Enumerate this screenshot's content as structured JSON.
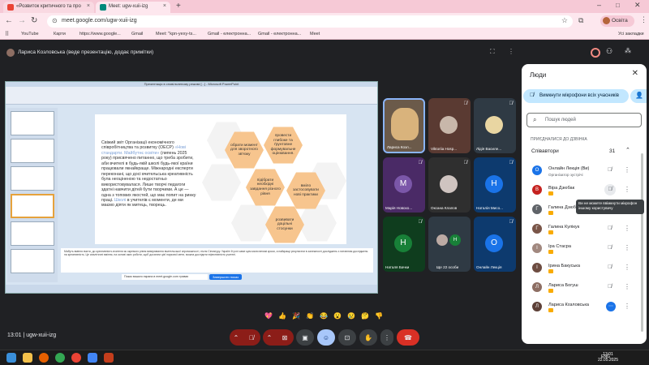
{
  "browser": {
    "tabs": [
      {
        "title": "«Розвиток критичного та про",
        "active": false
      },
      {
        "title": "Meet: ugw-xuii-izg",
        "active": true
      }
    ],
    "url": "meet.google.com/ugw-xuii-izg",
    "profile": "Освіта",
    "bookmarks": [
      "YouTube",
      "Карти",
      "https://www.google...",
      "Gmail",
      "Meet: \"kpn-yexy-ts...",
      "Gmail - електронна...",
      "Gmail - електронна...",
      "Meet"
    ],
    "all_bookmarks": "Усі закладки"
  },
  "meet": {
    "presenter_label": "Лариса Козловська (веде презентацію, додає примітки)",
    "slide": {
      "window_title": "Презентація в сповільненому режимі [...] - Microsoft PowerPoint",
      "text_before": "Свіжий звіт Організації економічного співробітництва та розвитку (ОЕСР) ",
      "text_link": "«Нові стандарти. Майбутнє освіти»",
      "text_mid": " (липень 2025 року) присвячено питанню, що треба зробити, аби вчителі в будь-якій школі будь-якої країни працювали якнайкраще. Міжнародні експерти переконані, що досі вчительська креативність була неоціненою та недостатньо використовувалася. Лише творчі педагоги здатні навчити дітей бути творчими. А це — одна з топових якостей, що має попит на ринку праці. ",
      "text_link2": "Школі",
      "text_after": " в учителів є моменти, де ми маємо діяти як митець, творець.",
      "hexagons": [
        "обрати момент для зворотного зв'язку",
        "провести глибоке та ґрунтовне формувальне оцінювання.",
        "підібрати необхідні завдання різного рівня",
        "вміло застосовувати нові практики",
        "розвивати доцільні стосунки"
      ],
      "notes": "Мабуть вміння вчити, до креативність вчителя як окремого рівня вимірювання вчительської спроможності, після Сінгапуру. Україні й учні саме цим мали великі кроки, а найкращі результати в залежності досліджень з питанням досліджень на креативність. Це аналітичні вміння, на основі яких робити, щоб досягати цієї наукової мети, можна дослідити ефективність учителі.",
      "stop_share": "Завершити показ",
      "share_notice": "Показ вашого екрана в meet.google.com триває"
    },
    "participants": [
      {
        "name": "Лариса Козл...",
        "initial": "",
        "color": "#6b5a4a",
        "muted": false
      },
      {
        "name": "Viktoriia Hosp...",
        "initial": "",
        "color": "#5a3a32",
        "muted": true
      },
      {
        "name": "Лідія Василе...",
        "initial": "",
        "color": "#2f3a44",
        "muted": true
      },
      {
        "name": "Марія Новохо...",
        "initial": "М",
        "color": "#7b57a9",
        "muted": true
      },
      {
        "name": "Оксана Клапов",
        "initial": "",
        "color": "#2f2f2f",
        "muted": true
      },
      {
        "name": "Наталія Мисо...",
        "initial": "Н",
        "color": "#1a73e8",
        "muted": true
      },
      {
        "name": "Наталя Бачки",
        "initial": "Н",
        "color": "#188038",
        "muted": true
      },
      {
        "name": "Ще 22 особи",
        "initial": "Н",
        "color": "#2f3a44",
        "muted": false
      },
      {
        "name": "Онлайн Лекція",
        "initial": "О",
        "color": "#1a73e8",
        "muted": true
      }
    ],
    "reactions": [
      "💖",
      "👍",
      "🎉",
      "👏",
      "😂",
      "😮",
      "😢",
      "🤔",
      "👎"
    ],
    "meeting_time": "13:01",
    "meeting_code": "ugw-xuii-izg",
    "controls": [
      "chevron-up",
      "mic-off",
      "chevron-up",
      "camera-off",
      "present",
      "emoji",
      "captions",
      "raise-hand",
      "more",
      "leave"
    ]
  },
  "people_panel": {
    "title": "Люди",
    "mute_all": "Вимкнути мікрофони всіх учасників",
    "search_placeholder": "Пошук людей",
    "joined_label": "ПРИЄДНАЛИСЯ ДО ДЗВІНКА",
    "contributors_label": "Співавтори",
    "contributors_count": "31",
    "people": [
      {
        "name": "Онлайн Лекція (Ви)",
        "subtitle": "Організатор зустрічі",
        "initial": "О",
        "color": "#1a73e8",
        "badge": false
      },
      {
        "name": "Віра Дзюбак",
        "subtitle": "",
        "initial": "В",
        "color": "#c5221f",
        "badge": true
      },
      {
        "name": "Галина Дзюба",
        "subtitle": "",
        "initial": "Г",
        "color": "#5f6368",
        "badge": true
      },
      {
        "name": "Галина Кулікук",
        "subtitle": "",
        "initial": "Г",
        "color": "#795548",
        "badge": true
      },
      {
        "name": "Іра Стасра",
        "subtitle": "",
        "initial": "І",
        "color": "#a1887f",
        "badge": true
      },
      {
        "name": "Ірина Бакуська",
        "subtitle": "",
        "initial": "І",
        "color": "#6d4c41",
        "badge": true
      },
      {
        "name": "Лариса Богуш",
        "subtitle": "",
        "initial": "Л",
        "color": "#8d6e63",
        "badge": true
      },
      {
        "name": "Лариса Козловська",
        "subtitle": "",
        "initial": "Л",
        "color": "#5d4037",
        "badge": true
      }
    ],
    "tooltip": "Ви не можете ввімкнути мікрофон іншому користувачу"
  },
  "taskbar": {
    "lang": "ENG",
    "time": "13:01",
    "date": "22.05.2025"
  }
}
